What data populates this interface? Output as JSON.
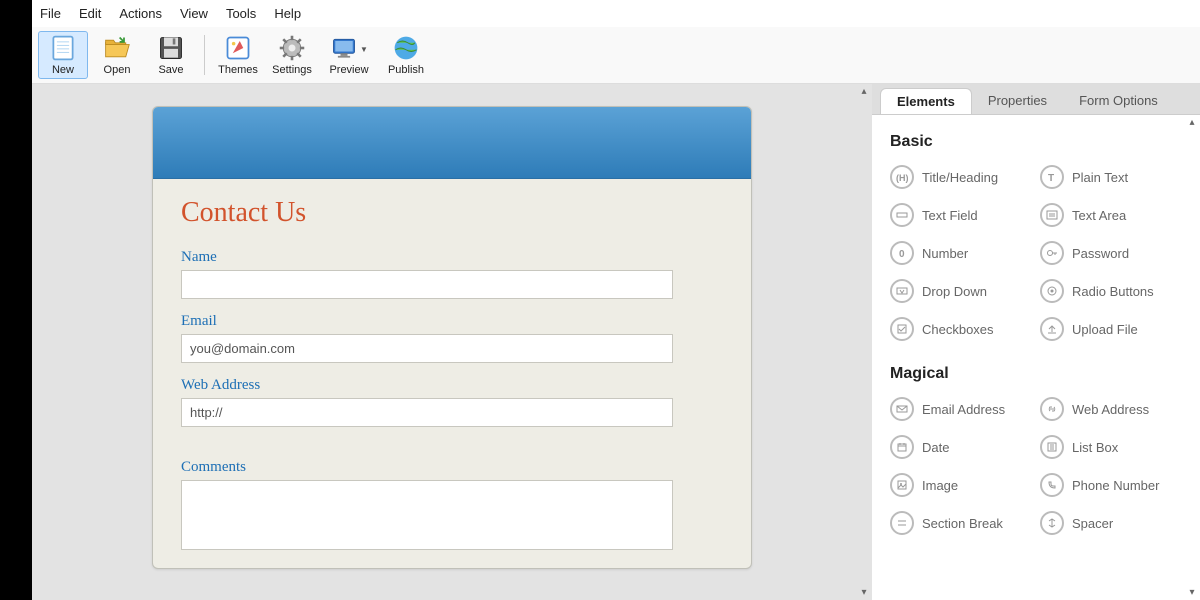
{
  "menubar": [
    "File",
    "Edit",
    "Actions",
    "View",
    "Tools",
    "Help"
  ],
  "toolbar": {
    "new": "New",
    "open": "Open",
    "save": "Save",
    "themes": "Themes",
    "settings": "Settings",
    "preview": "Preview",
    "publish": "Publish"
  },
  "form": {
    "title": "Contact Us",
    "fields": {
      "name_label": "Name",
      "name_value": "",
      "email_label": "Email",
      "email_value": "you@domain.com",
      "web_label": "Web Address",
      "web_value": "http://",
      "comments_label": "Comments"
    }
  },
  "sidepanel": {
    "tabs": {
      "elements": "Elements",
      "properties": "Properties",
      "form_options": "Form Options"
    },
    "sections": {
      "basic": {
        "title": "Basic",
        "items": {
          "title_heading": "Title/Heading",
          "plain_text": "Plain Text",
          "text_field": "Text Field",
          "text_area": "Text Area",
          "number": "Number",
          "password": "Password",
          "drop_down": "Drop Down",
          "radio_buttons": "Radio Buttons",
          "checkboxes": "Checkboxes",
          "upload_file": "Upload File"
        }
      },
      "magical": {
        "title": "Magical",
        "items": {
          "email_address": "Email Address",
          "web_address": "Web Address",
          "date": "Date",
          "list_box": "List Box",
          "image": "Image",
          "phone_number": "Phone Number",
          "section_break": "Section Break",
          "spacer": "Spacer"
        }
      }
    }
  }
}
